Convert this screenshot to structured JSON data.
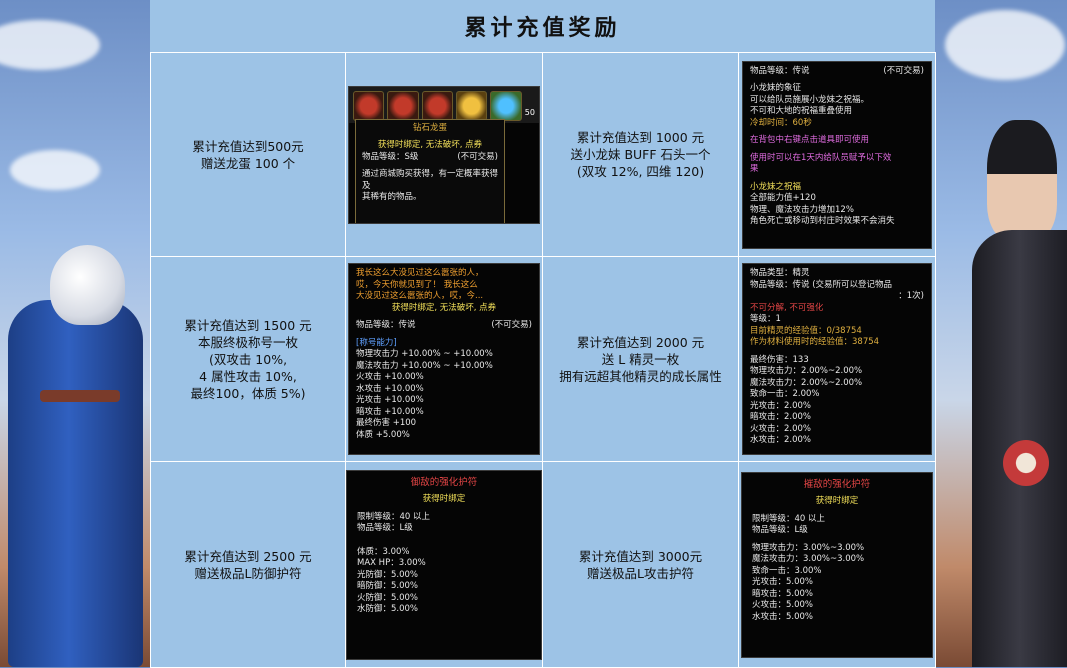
{
  "title": "累计充值奖励",
  "rows": [
    {
      "left": {
        "lines": [
          "累计充值达到500元",
          "赠送龙蛋 100 个"
        ]
      },
      "left_item": {
        "popup_title": "钻石龙蛋",
        "bind": "获得时绑定, 无法破坏, 点券",
        "grade_label": "物品等级：",
        "grade": "S级",
        "trade": "(不可交易)",
        "desc1": "通过商城购买获得，有一定概率获得及",
        "desc2": "其稀有的物品。",
        "slot_count": "50"
      },
      "right": {
        "lines": [
          "累计充值达到 1000 元",
          "送小龙妹 BUFF 石头一个",
          "(双攻 12%, 四维 120)"
        ]
      },
      "right_item": {
        "grade_label": "物品等级：",
        "grade": "传说",
        "trade": "(不可交易)",
        "l1": "小龙妹的象征",
        "l2": "可以给队员施展小龙妹之祝福。",
        "l3": "不可和大地的祝福重叠使用",
        "l4": "冷却时间：60秒",
        "l5": "在背包中右键点击道具即可使用",
        "l6": "使用时可以在1天内给队员赋予以下效",
        "l7": "果",
        "l8": "小龙妹之祝福",
        "l9": "全部能力值+120",
        "l10": "物理、魔法攻击力增加12%",
        "l11": "角色死亡或移动到村庄时效果不会消失"
      }
    },
    {
      "left": {
        "lines": [
          "累计充值达到 1500 元",
          "本服终极称号一枚",
          "(双攻击 10%,",
          "4 属性攻击 10%,",
          "最终100，体质 5%)"
        ]
      },
      "left_item": {
        "q1": "我长这么大没见过这么嚣张的人，",
        "q2": "哎，今天你就见到了！ 我长这么",
        "q3": "大没见过这么嚣张的人，哎，今...",
        "bind": "获得时绑定, 无法破坏, 点券",
        "grade_label": "物品等级：",
        "grade": "传说",
        "trade": "(不可交易)",
        "section": "[称号能力]",
        "s1": "物理攻击力 +10.00% ~ +10.00%",
        "s2": "魔法攻击力 +10.00% ~ +10.00%",
        "s3": "火攻击 +10.00%",
        "s4": "水攻击 +10.00%",
        "s5": "光攻击 +10.00%",
        "s6": "暗攻击 +10.00%",
        "s7": "最终伤害 +100",
        "s8": "体质 +5.00%"
      },
      "right": {
        "lines": [
          "累计充值达到 2000 元",
          "送 L 精灵一枚",
          "拥有远超其他精灵的成长属性"
        ]
      },
      "right_item": {
        "type_label": "物品类型：",
        "type": "精灵",
        "grade_label": "物品等级：",
        "grade": "传说 (交易所可以登记物品",
        "grade2": "：1次)",
        "no": "不可分解, 不可强化",
        "lvl": "等级：1",
        "exp1": "目前精灵的经验值：0/38754",
        "exp2": "作为材料使用时的经验值：38754",
        "s1": "最终伤害：133",
        "s2": "物理攻击力：2.00%~2.00%",
        "s3": "魔法攻击力：2.00%~2.00%",
        "s4": "致命一击：2.00%",
        "s5": "光攻击：2.00%",
        "s6": "暗攻击：2.00%",
        "s7": "火攻击：2.00%",
        "s8": "水攻击：2.00%"
      }
    },
    {
      "left": {
        "lines": [
          "累计充值达到 2500 元",
          "赠送极品L防御护符"
        ]
      },
      "left_item": {
        "name": "御敌的强化护符",
        "bind": "获得时绑定",
        "req": "限制等级：40 以上",
        "grade": "物品等级：L级",
        "s1": "体质：3.00%",
        "s2": "MAX HP：3.00%",
        "s3": "光防御：5.00%",
        "s4": "暗防御：5.00%",
        "s5": "火防御：5.00%",
        "s6": "水防御：5.00%"
      },
      "right": {
        "lines": [
          "累计充值达到 3000元",
          "赠送极品L攻击护符"
        ]
      },
      "right_item": {
        "name": "摧敌的强化护符",
        "bind": "获得时绑定",
        "req": "限制等级：40 以上",
        "grade": "物品等级：L级",
        "s1": "物理攻击力：3.00%~3.00%",
        "s2": "魔法攻击力：3.00%~3.00%",
        "s3": "致命一击：3.00%",
        "s4": "光攻击：5.00%",
        "s5": "暗攻击：5.00%",
        "s6": "火攻击：5.00%",
        "s7": "水攻击：5.00%"
      }
    }
  ]
}
